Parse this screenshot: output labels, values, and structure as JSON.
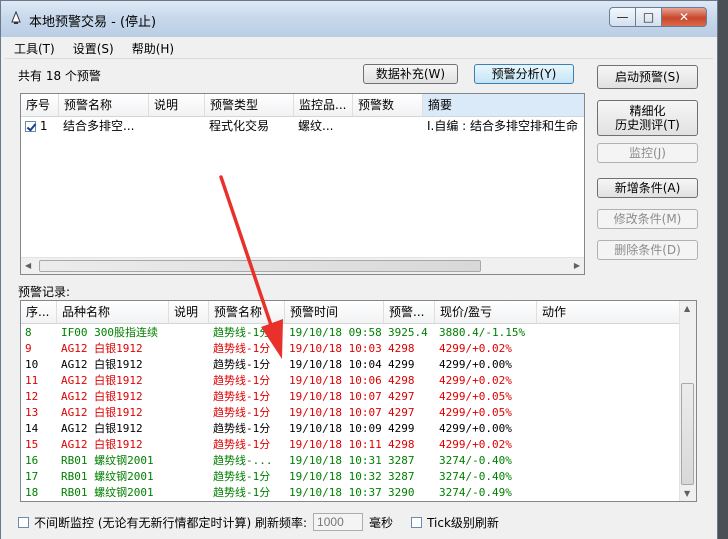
{
  "window": {
    "title": "本地预警交易 - (停止)",
    "min_glyph": "—",
    "max_glyph": "□",
    "close_glyph": "✕"
  },
  "menu": [
    "工具(T)",
    "设置(S)",
    "帮助(H)"
  ],
  "summary": "共有 18 个预警",
  "buttons": {
    "data_fill": "数据补充(W)",
    "analysis": "预警分析(Y)",
    "start": "启动预警(S)",
    "backtest_line1": "精细化",
    "backtest_line2": "历史测评(T)",
    "monitor": "监控(J)",
    "add": "新增条件(A)",
    "modify": "修改条件(M)",
    "delete": "删除条件(D)"
  },
  "alerts_table": {
    "columns": [
      "序号",
      "预警名称",
      "说明",
      "预警类型",
      "监控品...",
      "预警数",
      "摘要"
    ],
    "rows": [
      {
        "checked": true,
        "no": "1",
        "name": "结合多排空...",
        "desc": "",
        "type": "程式化交易",
        "target": "螺纹...",
        "count": "",
        "summary": "I.自编 : 结合多排空排和生命"
      }
    ]
  },
  "records_label": "预警记录:",
  "records_table": {
    "columns": [
      "序...",
      "品种名称",
      "说明",
      "预警名称",
      "预警时间",
      "预警...",
      "现价/盈亏",
      "动作"
    ],
    "rows": [
      {
        "color": "green",
        "no": "8",
        "product": "IF00 300股指连续",
        "desc": "",
        "alert": "趋势线-1分",
        "time": "19/10/18 09:58",
        "price": "3925.4",
        "pnl": "3880.4/-1.15%",
        "action": ""
      },
      {
        "color": "red",
        "no": "9",
        "product": "AG12 白银1912",
        "desc": "",
        "alert": "趋势线-1分",
        "time": "19/10/18 10:03",
        "price": "4298",
        "pnl": "4299/+0.02%",
        "action": ""
      },
      {
        "color": "black",
        "no": "10",
        "product": "AG12 白银1912",
        "desc": "",
        "alert": "趋势线-1分",
        "time": "19/10/18 10:04",
        "price": "4299",
        "pnl": "4299/+0.00%",
        "action": ""
      },
      {
        "color": "red",
        "no": "11",
        "product": "AG12 白银1912",
        "desc": "",
        "alert": "趋势线-1分",
        "time": "19/10/18 10:06",
        "price": "4298",
        "pnl": "4299/+0.02%",
        "action": ""
      },
      {
        "color": "red",
        "no": "12",
        "product": "AG12 白银1912",
        "desc": "",
        "alert": "趋势线-1分",
        "time": "19/10/18 10:07",
        "price": "4297",
        "pnl": "4299/+0.05%",
        "action": ""
      },
      {
        "color": "red",
        "no": "13",
        "product": "AG12 白银1912",
        "desc": "",
        "alert": "趋势线-1分",
        "time": "19/10/18 10:07",
        "price": "4297",
        "pnl": "4299/+0.05%",
        "action": ""
      },
      {
        "color": "black",
        "no": "14",
        "product": "AG12 白银1912",
        "desc": "",
        "alert": "趋势线-1分",
        "time": "19/10/18 10:09",
        "price": "4299",
        "pnl": "4299/+0.00%",
        "action": ""
      },
      {
        "color": "red",
        "no": "15",
        "product": "AG12 白银1912",
        "desc": "",
        "alert": "趋势线-1分",
        "time": "19/10/18 10:11",
        "price": "4298",
        "pnl": "4299/+0.02%",
        "action": ""
      },
      {
        "color": "green",
        "no": "16",
        "product": "RB01 螺纹钢2001",
        "desc": "",
        "alert": "趋势线-...",
        "time": "19/10/18 10:31",
        "price": "3287",
        "pnl": "3274/-0.40%",
        "action": ""
      },
      {
        "color": "green",
        "no": "17",
        "product": "RB01 螺纹钢2001",
        "desc": "",
        "alert": "趋势线-1分",
        "time": "19/10/18 10:32",
        "price": "3287",
        "pnl": "3274/-0.40%",
        "action": ""
      },
      {
        "color": "green",
        "no": "18",
        "product": "RB01 螺纹钢2001",
        "desc": "",
        "alert": "趋势线-1分",
        "time": "19/10/18 10:37",
        "price": "3290",
        "pnl": "3274/-0.49%",
        "action": ""
      }
    ]
  },
  "bottom": {
    "continuous_label": "不间断监控 (无论有无新行情都定时计算) 刷新频率:",
    "rate_value": "1000",
    "unit": "毫秒",
    "tick_label": "Tick级别刷新"
  },
  "colors": {
    "green": "#008000",
    "red": "#e00000",
    "annotation": "#e8312a"
  },
  "annotation": {
    "shape": "red arrow pointing to first record row"
  }
}
